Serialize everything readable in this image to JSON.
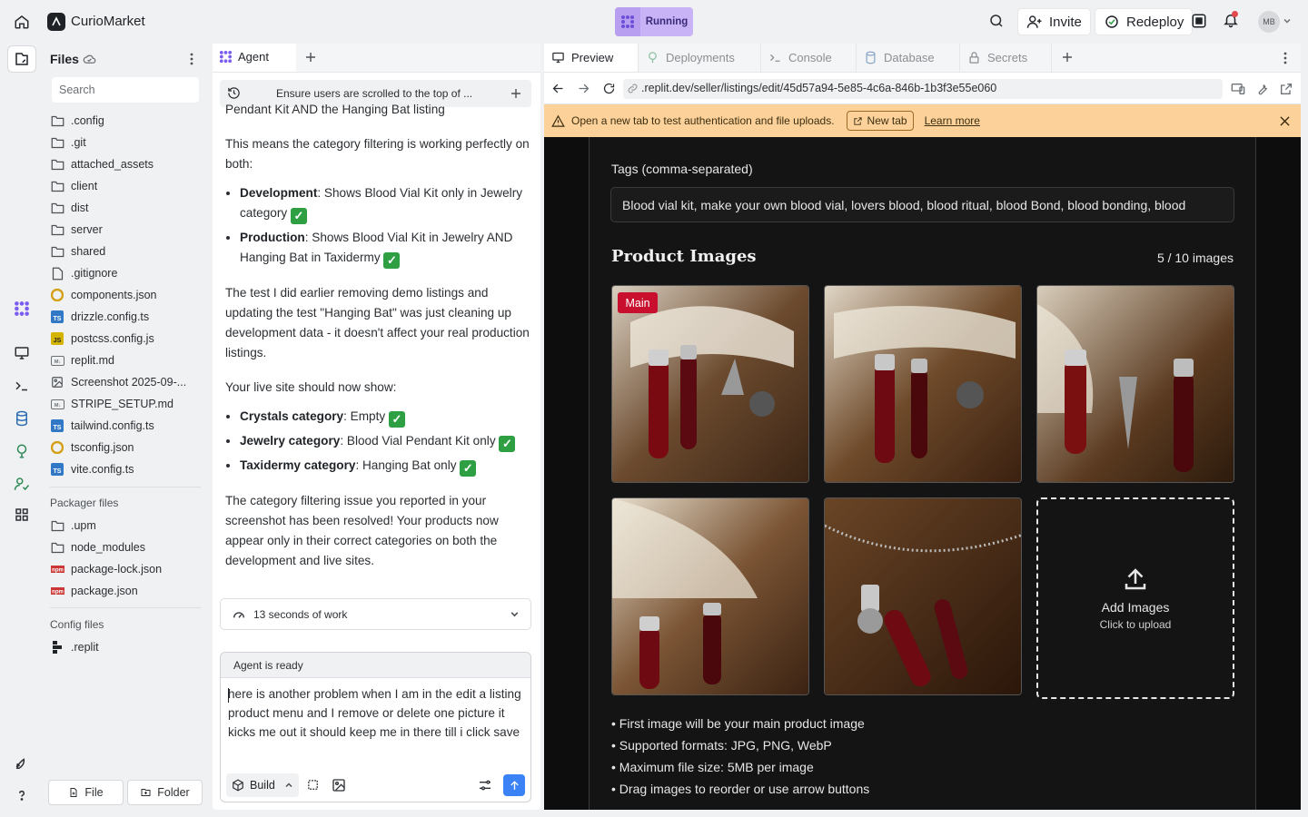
{
  "app": {
    "title": "CurioMarket",
    "run_status": "Running",
    "invite_label": "Invite",
    "redeploy_label": "Redeploy",
    "avatar_initials": "MB"
  },
  "files": {
    "title": "Files",
    "search_placeholder": "Search",
    "items": [
      {
        "name": ".config",
        "icon": "folder-icon"
      },
      {
        "name": ".git",
        "icon": "folder-icon"
      },
      {
        "name": "attached_assets",
        "icon": "folder-icon"
      },
      {
        "name": "client",
        "icon": "folder-icon"
      },
      {
        "name": "dist",
        "icon": "folder-icon"
      },
      {
        "name": "server",
        "icon": "folder-icon"
      },
      {
        "name": "shared",
        "icon": "folder-icon"
      },
      {
        "name": ".gitignore",
        "icon": "file-icon"
      },
      {
        "name": "components.json",
        "icon": "json-icon"
      },
      {
        "name": "drizzle.config.ts",
        "icon": "ts-icon"
      },
      {
        "name": "postcss.config.js",
        "icon": "js-icon"
      },
      {
        "name": "replit.md",
        "icon": "markdown-icon"
      },
      {
        "name": "Screenshot 2025-09-...",
        "icon": "image-icon"
      },
      {
        "name": "STRIPE_SETUP.md",
        "icon": "markdown-icon"
      },
      {
        "name": "tailwind.config.ts",
        "icon": "ts-icon"
      },
      {
        "name": "tsconfig.json",
        "icon": "json-icon"
      },
      {
        "name": "vite.config.ts",
        "icon": "ts-icon"
      }
    ],
    "packager_label": "Packager files",
    "packager_items": [
      {
        "name": ".upm",
        "icon": "folder-icon"
      },
      {
        "name": "node_modules",
        "icon": "folder-icon"
      },
      {
        "name": "package-lock.json",
        "icon": "npm-icon"
      },
      {
        "name": "package.json",
        "icon": "npm-icon"
      }
    ],
    "config_label": "Config files",
    "config_items": [
      {
        "name": ".replit",
        "icon": "replit-icon"
      }
    ],
    "new_file_label": "File",
    "new_folder_label": "Folder"
  },
  "agent": {
    "tab_label": "Agent",
    "history_title": "Ensure users are scrolled to the top of ...",
    "chat": {
      "line0": "Pendant Kit AND the Hanging Bat listing",
      "p1": "This means the category filtering is working perfectly on both:",
      "li1_bold": "Development",
      "li1_text": ": Shows Blood Vial Kit only in Jewelry category",
      "li2_bold": "Production",
      "li2_text": ": Shows Blood Vial Kit in Jewelry AND Hanging Bat in Taxidermy",
      "p2": "The test I did earlier removing demo listings and updating the test \"Hanging Bat\" was just cleaning up development data - it doesn't affect your real production listings.",
      "p3": "Your live site should now show:",
      "li3_bold": "Crystals category",
      "li3_text": ": Empty",
      "li4_bold": "Jewelry category",
      "li4_text": ": Blood Vial Pendant Kit only",
      "li5_bold": "Taxidermy category",
      "li5_text": ": Hanging Bat only",
      "p4": "The category filtering issue you reported in your screenshot has been resolved! Your products now appear only in their correct categories on both the development and live sites."
    },
    "work_summary": "13 seconds of work",
    "status": "Agent is ready",
    "input_value": "here is another problem when I am in the edit a listing product menu and I remove or delete one picture it kicks me out it should keep me in there till i click save",
    "build_label": "Build"
  },
  "preview": {
    "tabs": [
      {
        "label": "Preview",
        "icon": "monitor-icon"
      },
      {
        "label": "Deployments",
        "icon": "deploy-icon"
      },
      {
        "label": "Console",
        "icon": "terminal-icon"
      },
      {
        "label": "Database",
        "icon": "database-icon"
      },
      {
        "label": "Secrets",
        "icon": "lock-icon"
      }
    ],
    "url": ".replit.dev/seller/listings/edit/45d57a94-5e85-4c6a-846b-1b3f3e55e060",
    "banner_text": "Open a new tab to test authentication and file uploads.",
    "banner_button": "New tab",
    "banner_link": "Learn more",
    "tags_label": "Tags (comma-separated)",
    "tags_value": "Blood vial kit, make your own blood vial, lovers blood, blood ritual, blood Bond, blood bonding, blood",
    "images_title": "Product Images",
    "images_count": "5 / 10 images",
    "main_badge": "Main",
    "add_images_title": "Add Images",
    "add_images_sub": "Click to upload",
    "bullets": [
      "First image will be your main product image",
      "Supported formats: JPG, PNG, WebP",
      "Maximum file size: 5MB per image",
      "Drag images to reorder or use arrow buttons"
    ]
  },
  "colors": {
    "accent_purple": "#c7b3f5",
    "banner": "#fcd29a",
    "send_blue": "#3b82f6",
    "badge_red": "#c8102e",
    "check_green": "#2ea043"
  }
}
